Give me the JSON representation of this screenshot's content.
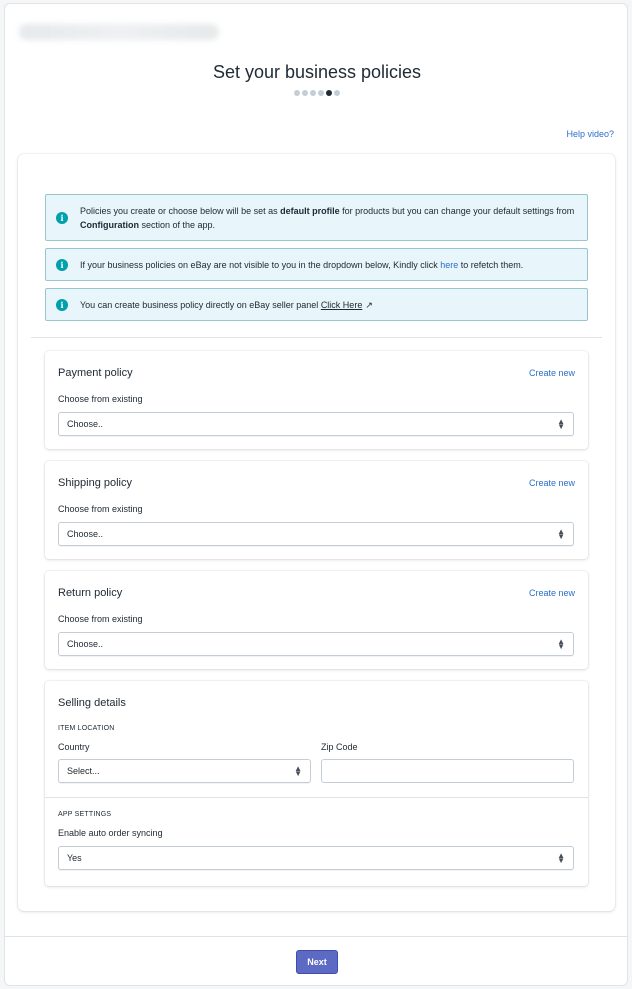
{
  "header": {
    "title": "Set your business policies",
    "steps_total": 6,
    "step_active": 5,
    "help_link": "Help video?"
  },
  "banners": {
    "default_profile": {
      "text1": "Policies you create or choose below will be set as ",
      "bold1": "default profile",
      "text2": " for products but you can change your default settings from ",
      "bold2": "Configuration",
      "text3": " section of the app."
    },
    "refetch": {
      "text1": "If your business policies on eBay are not visible to you in the dropdown below, Kindly click ",
      "link": "here",
      "text2": " to refetch them."
    },
    "seller_panel": {
      "text1": "You can create business policy directly on eBay seller panel ",
      "link": "Click Here"
    }
  },
  "payment": {
    "title": "Payment policy",
    "create_link": "Create new",
    "label": "Choose from existing",
    "value": "Choose.."
  },
  "shipping": {
    "title": "Shipping policy",
    "create_link": "Create new",
    "label": "Choose from existing",
    "value": "Choose.."
  },
  "return": {
    "title": "Return policy",
    "create_link": "Create new",
    "label": "Choose from existing",
    "value": "Choose.."
  },
  "selling": {
    "title": "Selling details",
    "item_location_heading": "ITEM LOCATION",
    "country_label": "Country",
    "country_value": "Select...",
    "zip_label": "Zip Code",
    "zip_value": "",
    "app_settings_heading": "APP SETTINGS",
    "auto_sync_label": "Enable auto order syncing",
    "auto_sync_value": "Yes"
  },
  "footer": {
    "next_label": "Next"
  },
  "colors": {
    "primary": "#5c6ac4",
    "link": "#2c6ecb",
    "info_icon": "#00a0ac",
    "banner_bg": "#e8f5fa"
  }
}
